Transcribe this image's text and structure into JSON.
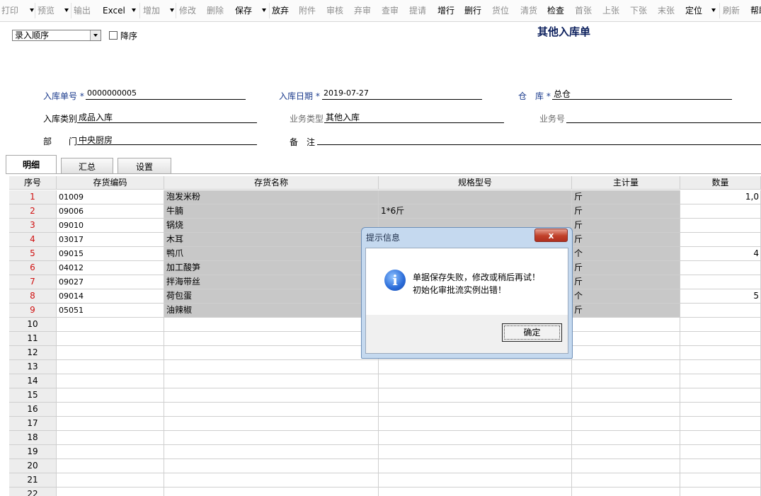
{
  "toolbar": {
    "items": [
      {
        "label": "打印",
        "state": "disabled",
        "arrow": true
      },
      {
        "label": "预览",
        "state": "disabled",
        "arrow": true
      },
      {
        "label": "输出",
        "state": "disabled",
        "arrow": false
      },
      {
        "label": "Excel",
        "state": "enabled",
        "arrow": true
      },
      {
        "label": "增加",
        "state": "disabled",
        "arrow": true
      },
      {
        "label": "修改",
        "state": "disabled",
        "arrow": false
      },
      {
        "label": "删除",
        "state": "disabled",
        "arrow": false
      },
      {
        "label": "保存",
        "state": "enabled",
        "arrow": true
      },
      {
        "label": "放弃",
        "state": "enabled",
        "arrow": false
      },
      {
        "label": "附件",
        "state": "disabled",
        "arrow": false
      },
      {
        "label": "审核",
        "state": "disabled",
        "arrow": false
      },
      {
        "label": "弃审",
        "state": "disabled",
        "arrow": false
      },
      {
        "label": "查审",
        "state": "disabled",
        "arrow": false
      },
      {
        "label": "提请",
        "state": "disabled",
        "arrow": false
      },
      {
        "label": "增行",
        "state": "enabled",
        "arrow": false
      },
      {
        "label": "删行",
        "state": "enabled",
        "arrow": false
      },
      {
        "label": "货位",
        "state": "disabled",
        "arrow": false
      },
      {
        "label": "清货",
        "state": "disabled",
        "arrow": false
      },
      {
        "label": "检查",
        "state": "enabled",
        "arrow": false
      },
      {
        "label": "首张",
        "state": "disabled",
        "arrow": false
      },
      {
        "label": "上张",
        "state": "disabled",
        "arrow": false
      },
      {
        "label": "下张",
        "state": "disabled",
        "arrow": false
      },
      {
        "label": "末张",
        "state": "disabled",
        "arrow": false
      },
      {
        "label": "定位",
        "state": "enabled",
        "arrow": true
      },
      {
        "label": "刷新",
        "state": "disabled",
        "arrow": false
      },
      {
        "label": "帮助",
        "state": "enabled",
        "arrow": false
      }
    ]
  },
  "header": {
    "sort_select": "录入顺序",
    "desc_label": "降序",
    "title": "其他入库单"
  },
  "form": {
    "receipt_no_label": "入库单号",
    "receipt_no": "0000000005",
    "date_label": "入库日期",
    "date": "2019-07-27",
    "warehouse_label": "仓　库",
    "warehouse": "总仓",
    "category_label": "入库类别",
    "category": "成品入库",
    "biz_type_label": "业务类型",
    "biz_type": "其他入库",
    "biz_no_label": "业务号",
    "biz_no": "",
    "dept_label": "部　　门",
    "dept": "中央厨房",
    "remark_label": "备　注",
    "remark": "",
    "required_mark": "*"
  },
  "tabs": [
    "明细",
    "汇总",
    "设置"
  ],
  "grid": {
    "columns": [
      "序号",
      "存货编码",
      "存货名称",
      "规格型号",
      "主计量",
      "数量"
    ],
    "rows": [
      {
        "no": "1",
        "code": "01009",
        "name": "泡发米粉",
        "spec": "",
        "unit": "斤",
        "qty": "1,0"
      },
      {
        "no": "2",
        "code": "09006",
        "name": "牛腩",
        "spec": "1*6斤",
        "unit": "斤",
        "qty": ""
      },
      {
        "no": "3",
        "code": "09010",
        "name": "锅烧",
        "spec": "",
        "unit": "斤",
        "qty": ""
      },
      {
        "no": "4",
        "code": "03017",
        "name": "木耳",
        "spec": "",
        "unit": "斤",
        "qty": ""
      },
      {
        "no": "5",
        "code": "09015",
        "name": "鸭爪",
        "spec": "",
        "unit": "个",
        "qty": "4"
      },
      {
        "no": "6",
        "code": "04012",
        "name": "加工酸笋",
        "spec": "",
        "unit": "斤",
        "qty": ""
      },
      {
        "no": "7",
        "code": "09027",
        "name": "拌海带丝",
        "spec": "",
        "unit": "斤",
        "qty": ""
      },
      {
        "no": "8",
        "code": "09014",
        "name": "荷包蛋",
        "spec": "",
        "unit": "个",
        "qty": "5"
      },
      {
        "no": "9",
        "code": "05051",
        "name": "油辣椒",
        "spec": "",
        "unit": "斤",
        "qty": ""
      }
    ],
    "empty_rows": [
      "10",
      "11",
      "12",
      "13",
      "14",
      "15",
      "16",
      "17",
      "18",
      "19",
      "20",
      "21",
      "22"
    ]
  },
  "dialog": {
    "title": "提示信息",
    "close": "x",
    "icon": "info-icon",
    "message_line1": "单据保存失败，修改或稍后再试！",
    "message_line2": "初始化审批流实例出错！",
    "ok_label": "确定"
  }
}
